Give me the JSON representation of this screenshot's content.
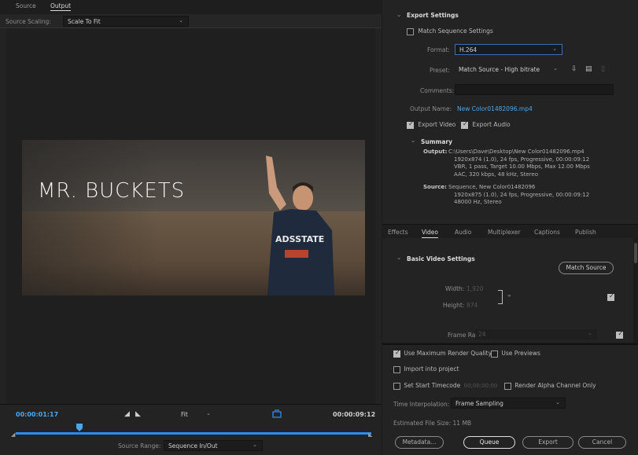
{
  "left": {
    "tabs": [
      {
        "label": "Source"
      },
      {
        "label": "Output"
      }
    ],
    "source_scaling": {
      "label": "Source Scaling:",
      "value": "Scale To Fit"
    },
    "video_title": "MR. BUCKETS",
    "jersey_text": "ADSSTATE",
    "timecode_in": "00:00:01:17",
    "timecode_out": "00:00:09:12",
    "zoom": "Fit",
    "playhead_fraction": 0.18,
    "source_range": {
      "label": "Source Range:",
      "value": "Sequence In/Out"
    }
  },
  "export": {
    "section_title": "Export Settings",
    "match_sequence": "Match Sequence Settings",
    "format_label": "Format:",
    "format_value": "H.264",
    "preset_label": "Preset:",
    "preset_value": "Match Source - High bitrate",
    "comments_label": "Comments:",
    "comments_value": "",
    "output_name_label": "Output Name:",
    "output_name_value": "New Color01482096.mp4",
    "export_video": "Export Video",
    "export_audio": "Export Audio",
    "summary_title": "Summary",
    "output_key": "Output:",
    "output_lines": [
      "C:\\Users\\Dave\\Desktop\\New Color01482096.mp4",
      "1920x874 (1.0), 24 fps, Progressive, 00:00:09:12",
      "VBR, 1 pass, Target 10.00 Mbps, Max 12.00 Mbps",
      "AAC, 320 kbps, 48 kHz, Stereo"
    ],
    "source_key": "Source:",
    "source_lines": [
      "Sequence, New Color01482096",
      "1920x875 (1.0), 24 fps, Progressive, 00:00:09:12",
      "48000 Hz, Stereo"
    ]
  },
  "tabs": [
    {
      "label": "Effects"
    },
    {
      "label": "Video"
    },
    {
      "label": "Audio"
    },
    {
      "label": "Multiplexer"
    },
    {
      "label": "Captions"
    },
    {
      "label": "Publish"
    }
  ],
  "video_settings": {
    "title": "Basic Video Settings",
    "match_source": "Match Source",
    "width_label": "Width:",
    "width_value": "1,920",
    "height_label": "Height:",
    "height_value": "874",
    "frame_rate_label": "Frame Rate:",
    "frame_rate_value": "24"
  },
  "bottom": {
    "max_render": "Use Maximum Render Quality",
    "use_previews": "Use Previews",
    "import_project": "Import into project",
    "set_start_tc": "Set Start Timecode",
    "start_tc_value": "00;00;00;00",
    "render_alpha": "Render Alpha Channel Only",
    "time_interp_label": "Time Interpolation:",
    "time_interp_value": "Frame Sampling",
    "file_size_label": "Estimated File Size:",
    "file_size_value": "11 MB",
    "metadata_btn": "Metadata...",
    "queue_btn": "Queue",
    "export_btn": "Export",
    "cancel_btn": "Cancel"
  },
  "colors": {
    "accent": "#2d8ceb",
    "link": "#4ea6ea",
    "panel": "#232323"
  }
}
